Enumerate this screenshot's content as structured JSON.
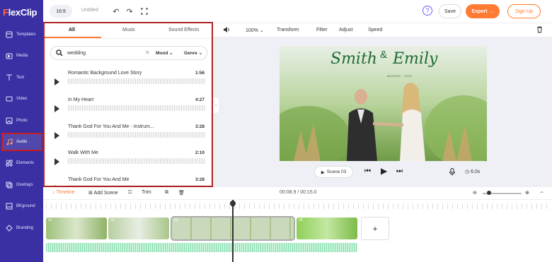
{
  "brand": {
    "name_pre": "F",
    "name_rest": "lexClip"
  },
  "leftnav": {
    "items": [
      {
        "label": "Templates",
        "icon": "templates-icon"
      },
      {
        "label": "Media",
        "icon": "media-icon"
      },
      {
        "label": "Text",
        "icon": "text-icon"
      },
      {
        "label": "Video",
        "icon": "video-icon"
      },
      {
        "label": "Photo",
        "icon": "photo-icon"
      },
      {
        "label": "Audio",
        "icon": "audio-icon"
      },
      {
        "label": "Elements",
        "icon": "elements-icon"
      },
      {
        "label": "Overlays",
        "icon": "overlays-icon"
      },
      {
        "label": "BKground",
        "icon": "bkground-icon"
      },
      {
        "label": "Branding",
        "icon": "branding-icon"
      }
    ],
    "active": "Audio"
  },
  "topbar": {
    "ratio": "16:9",
    "title": "Untitled",
    "help": "?",
    "save": "Save",
    "export": "Export →",
    "signup": "Sign Up"
  },
  "panel": {
    "tabs": [
      "All",
      "Music",
      "Sound Effects"
    ],
    "active_tab": "All",
    "search_value": "wedding",
    "filters": [
      "Mood",
      "Genre"
    ],
    "tracks": [
      {
        "name": "Romantic Background Love Story",
        "duration": "1:56"
      },
      {
        "name": "In My Heart",
        "duration": "4:27"
      },
      {
        "name": "Thank God For You And Me - Instrum...",
        "duration": "3:28"
      },
      {
        "name": "Walk With Me",
        "duration": "2:10"
      },
      {
        "name": "Thank God For You And Me",
        "duration": "3:28"
      }
    ]
  },
  "edit_toolbar": {
    "zoom": "100%",
    "items": [
      "Transform",
      "Filter",
      "Adjust",
      "Speed"
    ]
  },
  "preview": {
    "name_left": "Smith",
    "ampersand": "&",
    "name_right": "Emily",
    "date": "AUGUST . 2023",
    "scene_label": "Scene 03",
    "duration": "6.0s"
  },
  "timeline": {
    "timeline_label": "Timeline",
    "add_scene": "Add Scene",
    "trim": "Trim",
    "timecode": "00:08.9 / 00:15.0",
    "clips": [
      "01",
      "02",
      "03",
      "04"
    ]
  },
  "colors": {
    "brand": "#3a2fa3",
    "accent": "#ff7a32",
    "highlight": "#b22222"
  }
}
